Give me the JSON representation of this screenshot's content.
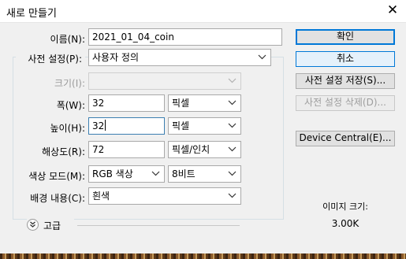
{
  "window": {
    "title": "새로 만들기"
  },
  "form": {
    "name_label": "이름(N):",
    "name_value": "2021_01_04_coin",
    "preset_label": "사전 설정(P):",
    "preset_value": "사용자 정의",
    "size_label": "크기(I):",
    "width_label": "폭(W):",
    "width_value": "32",
    "width_unit": "픽셀",
    "height_label": "높이(H):",
    "height_value": "32",
    "height_unit": "픽셀",
    "resolution_label": "해상도(R):",
    "resolution_value": "72",
    "resolution_unit": "픽셀/인치",
    "color_mode_label": "색상 모드(M):",
    "color_mode_value": "RGB 색상",
    "bit_depth_value": "8비트",
    "background_label": "배경 내용(C):",
    "background_value": "흰색",
    "advanced_label": "고급"
  },
  "buttons": {
    "ok": "확인",
    "cancel": "취소",
    "save_preset": "사전 설정 저장(S)...",
    "delete_preset": "사전 설정 삭제(D)...",
    "device_central": "Device Central(E)..."
  },
  "info": {
    "image_size_label": "이미지 크기:",
    "image_size_value": "3.00K"
  }
}
